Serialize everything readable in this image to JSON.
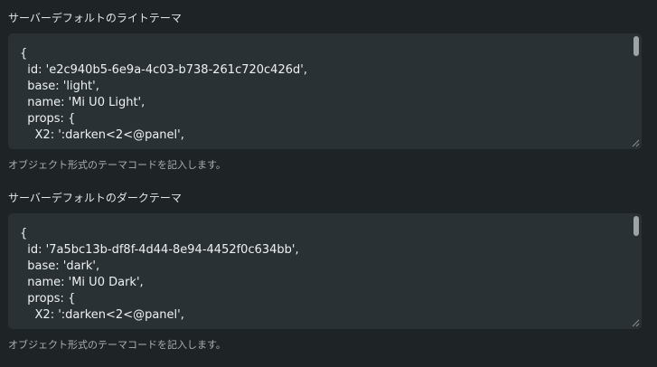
{
  "light_theme": {
    "label": "サーバーデフォルトのライトテーマ",
    "code": "{\n  id: 'e2c940b5-6e9a-4c03-b738-261c720c426d',\n  base: 'light',\n  name: 'Mi U0 Light',\n  props: {\n    X2: ':darken<2<@panel',",
    "help": "オブジェクト形式のテーマコードを記入します。"
  },
  "dark_theme": {
    "label": "サーバーデフォルトのダークテーマ",
    "code": "{\n  id: '7a5bc13b-df8f-4d44-8e94-4452f0c634bb',\n  base: 'dark',\n  name: 'Mi U0 Dark',\n  props: {\n    X2: ':darken<2<@panel',",
    "help": "オブジェクト形式のテーマコードを記入します。"
  },
  "icons": {
    "scrollbar": "scrollbar-thumb",
    "resize": "resize-grip-icon"
  },
  "colors": {
    "background": "#1e2326",
    "editor_bg": "#2a3134",
    "text": "#eef1f2",
    "muted": "#a9afb2"
  }
}
